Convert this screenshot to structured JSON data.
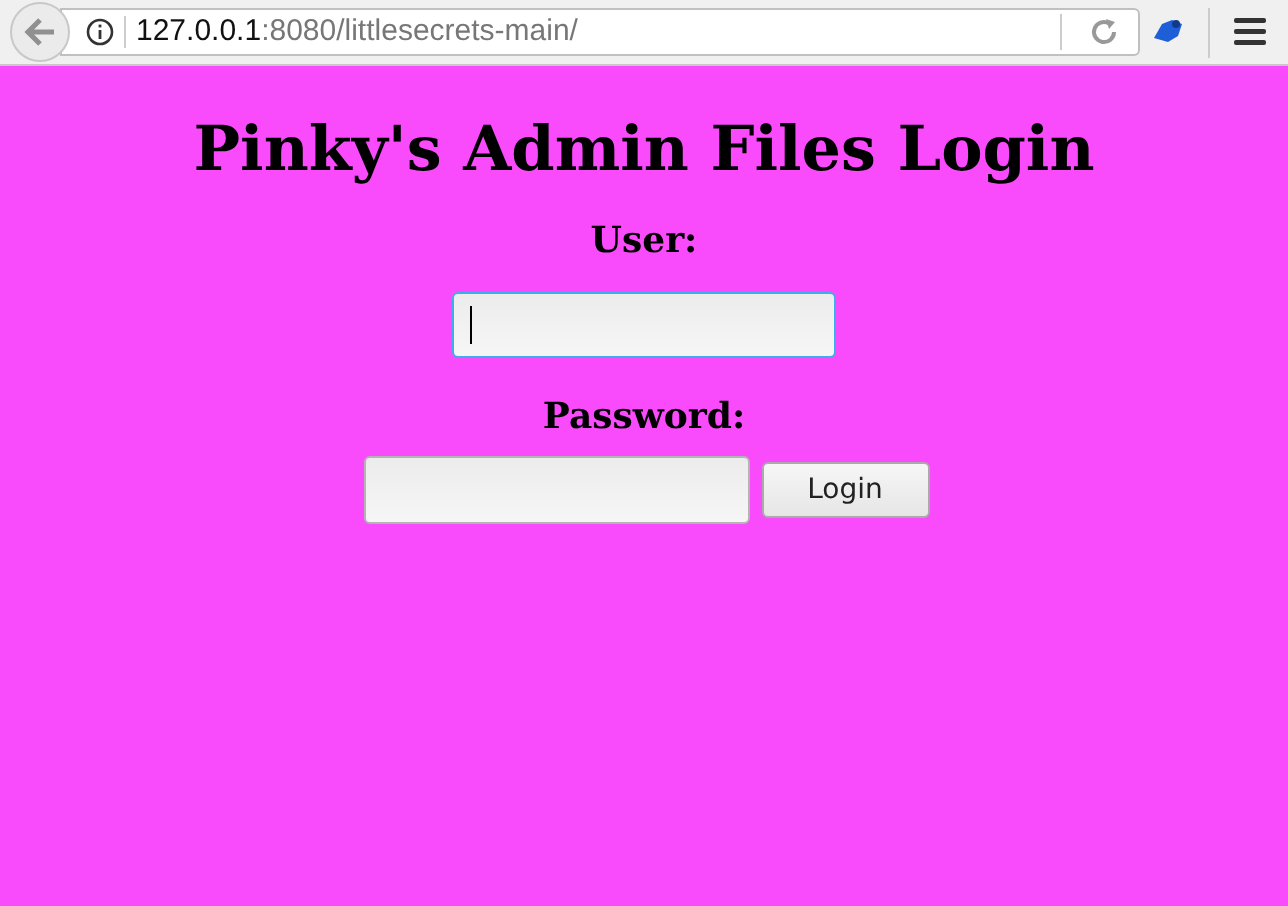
{
  "browser": {
    "url": {
      "host": "127.0.0.1",
      "rest": ":8080/littlesecrets-main/"
    }
  },
  "page": {
    "title": "Pinky's Admin Files Login",
    "fields": [
      {
        "label": "User:",
        "focused": true
      },
      {
        "label": "Password:",
        "focused": false
      }
    ],
    "button": "Login"
  }
}
